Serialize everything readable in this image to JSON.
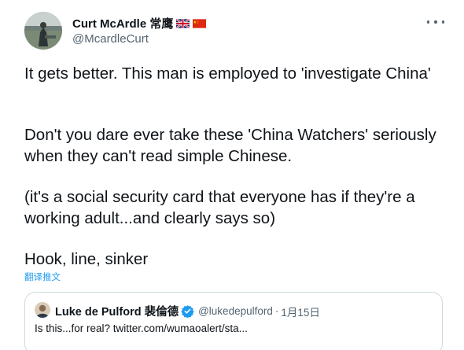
{
  "author": {
    "name": "Curt McArdle 常鹰",
    "handle": "@McardleCurt",
    "flags": [
      "uk-flag-icon",
      "china-flag-icon"
    ]
  },
  "tweet": {
    "paragraphs": [
      "It gets better. This man is employed to 'investigate China'",
      "Don't you dare ever take these 'China Watchers' seriously when they can't read simple Chinese.",
      "(it's a social security card that everyone has if they're a working adult...and clearly says so)",
      "Hook, line, sinker"
    ],
    "translate_label": "翻译推文"
  },
  "quote": {
    "name": "Luke de Pulford 裴倫德",
    "handle": "@lukedepulford",
    "separator": "·",
    "date": "1月15日",
    "text": "Is this...for real? twitter.com/wumaoalert/sta..."
  },
  "colors": {
    "text": "#0f1419",
    "secondary": "#536471",
    "link": "#1d9bf0",
    "border": "#cfd9de"
  }
}
